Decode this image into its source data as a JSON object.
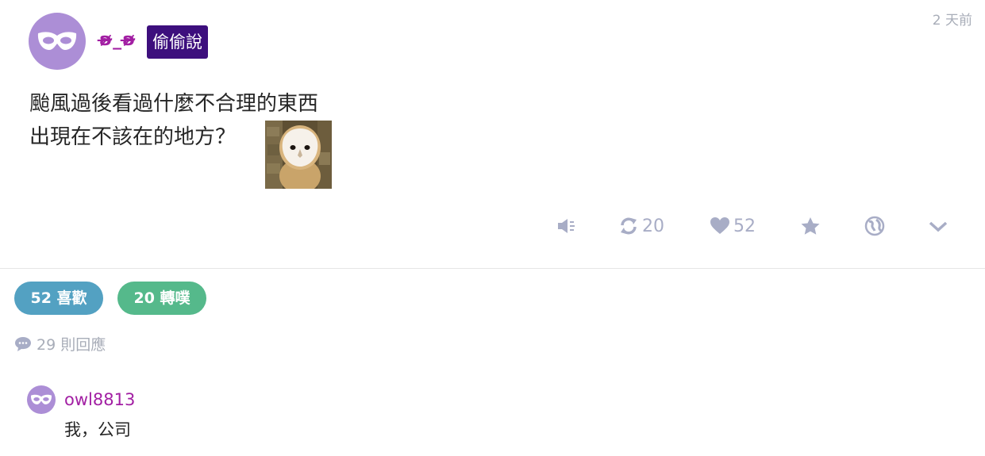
{
  "post": {
    "nickname": "ʚ̴̶̷̷_ʚ̴̶̷̷",
    "qualifier": "偷偷說",
    "time": "2 天前",
    "content_line1": "颱風過後看過什麼不合理的東西",
    "content_line2": "出現在不該在的地方？",
    "avatar_icon": "mask-icon",
    "attached_image": "barn owl peeking from stone wall"
  },
  "actions": {
    "mute_icon": "speaker-mute-icon",
    "replurk_count": "20",
    "like_count": "52",
    "favorite_icon": "star-icon",
    "share_icon": "globe-icon",
    "more_icon": "chevron-down-icon"
  },
  "stats": {
    "likes_label": "52 喜歡",
    "replurks_label": "20 轉噗",
    "responses_label": "29 則回應"
  },
  "response": {
    "username": "owl8813",
    "text": "我，公司"
  },
  "colors": {
    "avatar": "#ac8ed6",
    "nickname": "#a21fa3",
    "qualifier_bg": "#3d0f7d",
    "likes_pill": "#53a1c2",
    "replurks_pill": "#55b98b",
    "muted_gray": "#a8adc6"
  }
}
